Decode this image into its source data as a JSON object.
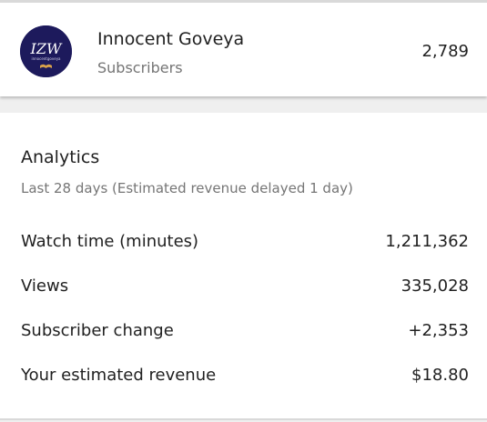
{
  "channel": {
    "name": "Innocent Goveya",
    "subscribers_label": "Subscribers",
    "subscribers_count": "2,789",
    "avatar_text": "IZW",
    "avatar_caption": "innocentgoveya",
    "avatar_color": "#1d1a5c"
  },
  "analytics": {
    "title": "Analytics",
    "period": "Last 28 days (Estimated revenue delayed 1 day)",
    "metrics": [
      {
        "label": "Watch time (minutes)",
        "value": "1,211,362"
      },
      {
        "label": "Views",
        "value": "335,028"
      },
      {
        "label": "Subscriber change",
        "value": "+2,353"
      },
      {
        "label": "Your estimated revenue",
        "value": "$18.80"
      }
    ]
  }
}
